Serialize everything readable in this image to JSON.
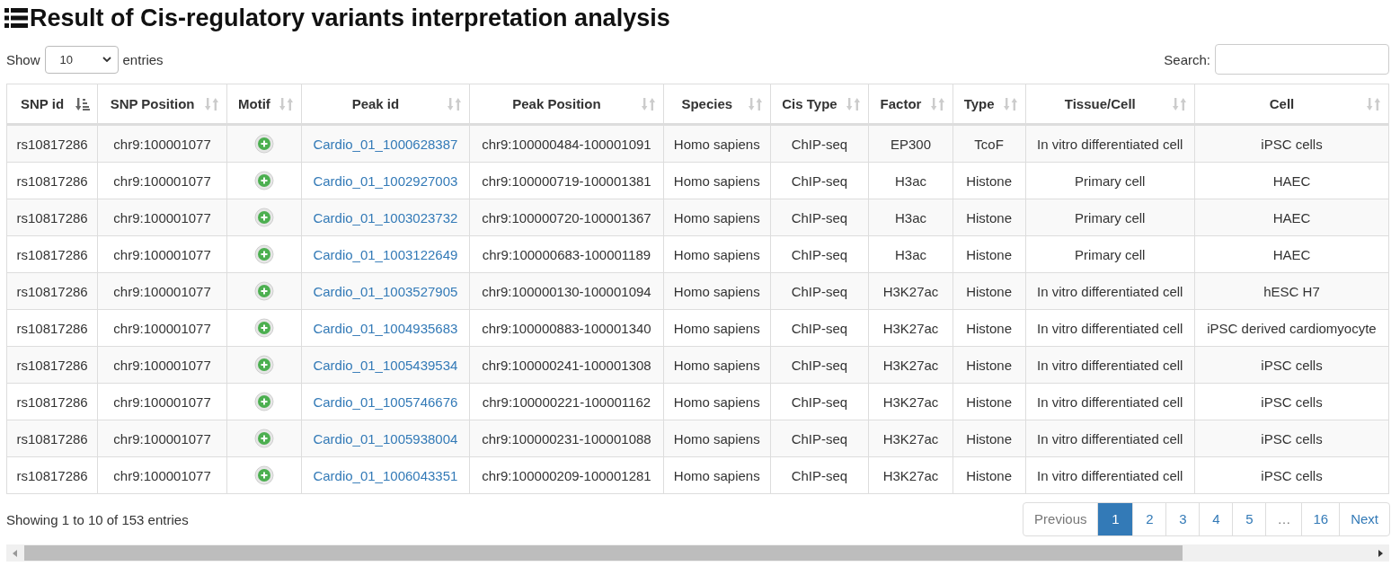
{
  "title": "Result of Cis-regulatory variants interpretation analysis",
  "length_control": {
    "label_before": "Show",
    "value": "10",
    "label_after": "entries"
  },
  "search": {
    "label": "Search:"
  },
  "table": {
    "columns": [
      {
        "label": "SNP id",
        "kind": "text",
        "sorted": true
      },
      {
        "label": "SNP Position",
        "kind": "text",
        "sorted": false
      },
      {
        "label": "Motif",
        "kind": "icon",
        "sorted": false
      },
      {
        "label": "Peak id",
        "kind": "link",
        "sorted": false
      },
      {
        "label": "Peak Position",
        "kind": "text",
        "sorted": false
      },
      {
        "label": "Species",
        "kind": "text",
        "sorted": false
      },
      {
        "label": "Cis Type",
        "kind": "text",
        "sorted": false
      },
      {
        "label": "Factor",
        "kind": "text",
        "sorted": false
      },
      {
        "label": "Type",
        "kind": "text",
        "sorted": false
      },
      {
        "label": "Tissue/Cell",
        "kind": "text",
        "sorted": false
      },
      {
        "label": "Cell",
        "kind": "text",
        "sorted": false
      }
    ],
    "rows": [
      {
        "cells": [
          "rs10817286",
          "chr9:100001077",
          "",
          "Cardio_01_1000628387",
          "chr9:100000484-100001091",
          "Homo sapiens",
          "ChIP-seq",
          "EP300",
          "TcoF",
          "In vitro differentiated cell",
          "iPSC cells"
        ]
      },
      {
        "cells": [
          "rs10817286",
          "chr9:100001077",
          "",
          "Cardio_01_1002927003",
          "chr9:100000719-100001381",
          "Homo sapiens",
          "ChIP-seq",
          "H3ac",
          "Histone",
          "Primary cell",
          "HAEC"
        ]
      },
      {
        "cells": [
          "rs10817286",
          "chr9:100001077",
          "",
          "Cardio_01_1003023732",
          "chr9:100000720-100001367",
          "Homo sapiens",
          "ChIP-seq",
          "H3ac",
          "Histone",
          "Primary cell",
          "HAEC"
        ]
      },
      {
        "cells": [
          "rs10817286",
          "chr9:100001077",
          "",
          "Cardio_01_1003122649",
          "chr9:100000683-100001189",
          "Homo sapiens",
          "ChIP-seq",
          "H3ac",
          "Histone",
          "Primary cell",
          "HAEC"
        ]
      },
      {
        "cells": [
          "rs10817286",
          "chr9:100001077",
          "",
          "Cardio_01_1003527905",
          "chr9:100000130-100001094",
          "Homo sapiens",
          "ChIP-seq",
          "H3K27ac",
          "Histone",
          "In vitro differentiated cell",
          "hESC H7"
        ]
      },
      {
        "cells": [
          "rs10817286",
          "chr9:100001077",
          "",
          "Cardio_01_1004935683",
          "chr9:100000883-100001340",
          "Homo sapiens",
          "ChIP-seq",
          "H3K27ac",
          "Histone",
          "In vitro differentiated cell",
          "iPSC derived cardiomyocyte"
        ]
      },
      {
        "cells": [
          "rs10817286",
          "chr9:100001077",
          "",
          "Cardio_01_1005439534",
          "chr9:100000241-100001308",
          "Homo sapiens",
          "ChIP-seq",
          "H3K27ac",
          "Histone",
          "In vitro differentiated cell",
          "iPSC cells"
        ]
      },
      {
        "cells": [
          "rs10817286",
          "chr9:100001077",
          "",
          "Cardio_01_1005746676",
          "chr9:100000221-100001162",
          "Homo sapiens",
          "ChIP-seq",
          "H3K27ac",
          "Histone",
          "In vitro differentiated cell",
          "iPSC cells"
        ]
      },
      {
        "cells": [
          "rs10817286",
          "chr9:100001077",
          "",
          "Cardio_01_1005938004",
          "chr9:100000231-100001088",
          "Homo sapiens",
          "ChIP-seq",
          "H3K27ac",
          "Histone",
          "In vitro differentiated cell",
          "iPSC cells"
        ]
      },
      {
        "cells": [
          "rs10817286",
          "chr9:100001077",
          "",
          "Cardio_01_1006043351",
          "chr9:100000209-100001281",
          "Homo sapiens",
          "ChIP-seq",
          "H3K27ac",
          "Histone",
          "In vitro differentiated cell",
          "iPSC cells"
        ]
      }
    ]
  },
  "info": "Showing 1 to 10 of 153 entries",
  "pagination": [
    {
      "label": "Previous",
      "selected": false,
      "disabled": true
    },
    {
      "label": "1",
      "selected": true,
      "disabled": false
    },
    {
      "label": "2",
      "selected": false,
      "disabled": false
    },
    {
      "label": "3",
      "selected": false,
      "disabled": false
    },
    {
      "label": "4",
      "selected": false,
      "disabled": false
    },
    {
      "label": "5",
      "selected": false,
      "disabled": false
    },
    {
      "label": "…",
      "selected": false,
      "disabled": true
    },
    {
      "label": "16",
      "selected": false,
      "disabled": false
    },
    {
      "label": "Next",
      "selected": false,
      "disabled": false
    }
  ]
}
